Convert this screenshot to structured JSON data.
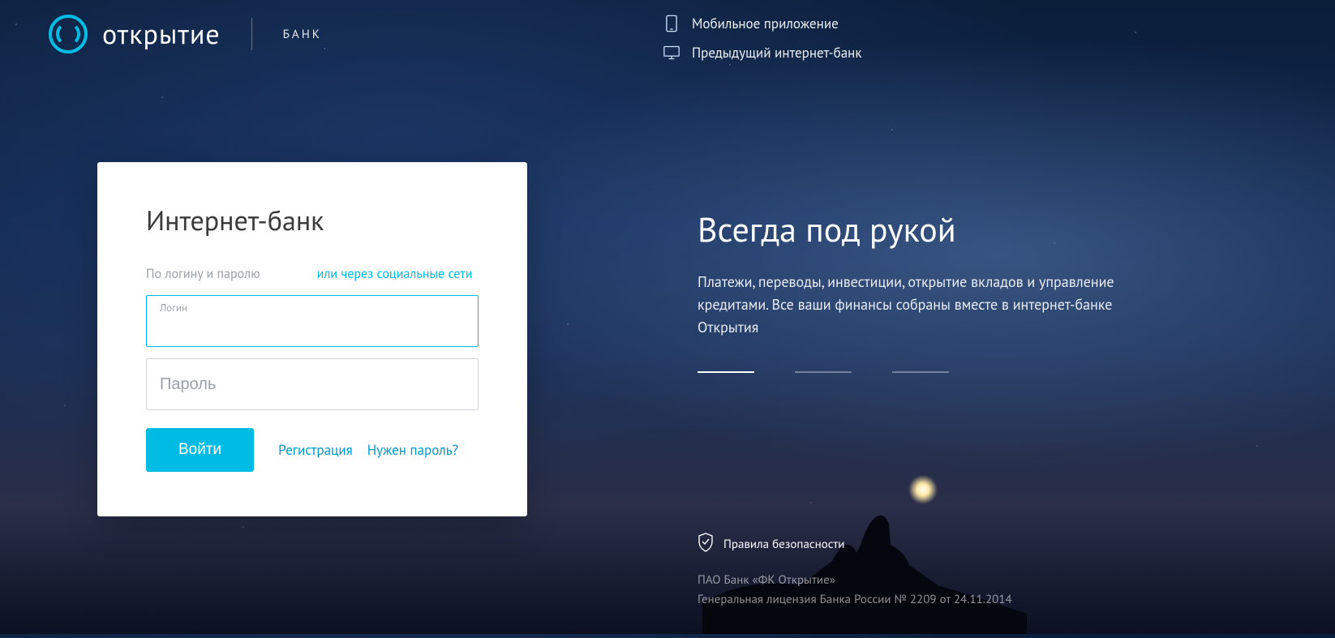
{
  "brand": {
    "name": "открытие",
    "sub": "БАНК"
  },
  "header": {
    "mobile_app": "Мобильное приложение",
    "previous_bank": "Предыдущий интернет-банк"
  },
  "login": {
    "title": "Интернет-банк",
    "tab_credentials": "По логину и паролю",
    "tab_social": "или через социальные сети",
    "login_label": "Логин",
    "password_placeholder": "Пароль",
    "submit": "Войти",
    "register": "Регистрация",
    "need_password": "Нужен пароль?"
  },
  "hero": {
    "title": "Всегда под рукой",
    "description": "Платежи, переводы, инвестиции, открытие вкладов и управление кредитами. Все ваши финансы собраны вместе в интернет-банке Открытия"
  },
  "footer": {
    "security_rules": "Правила безопасности",
    "legal_line1": "ПАО Банк «ФК Открытие»",
    "legal_line2": "Генеральная лицензия Банка России № 2209 от 24.11.2014"
  },
  "colors": {
    "accent": "#00bce4"
  }
}
